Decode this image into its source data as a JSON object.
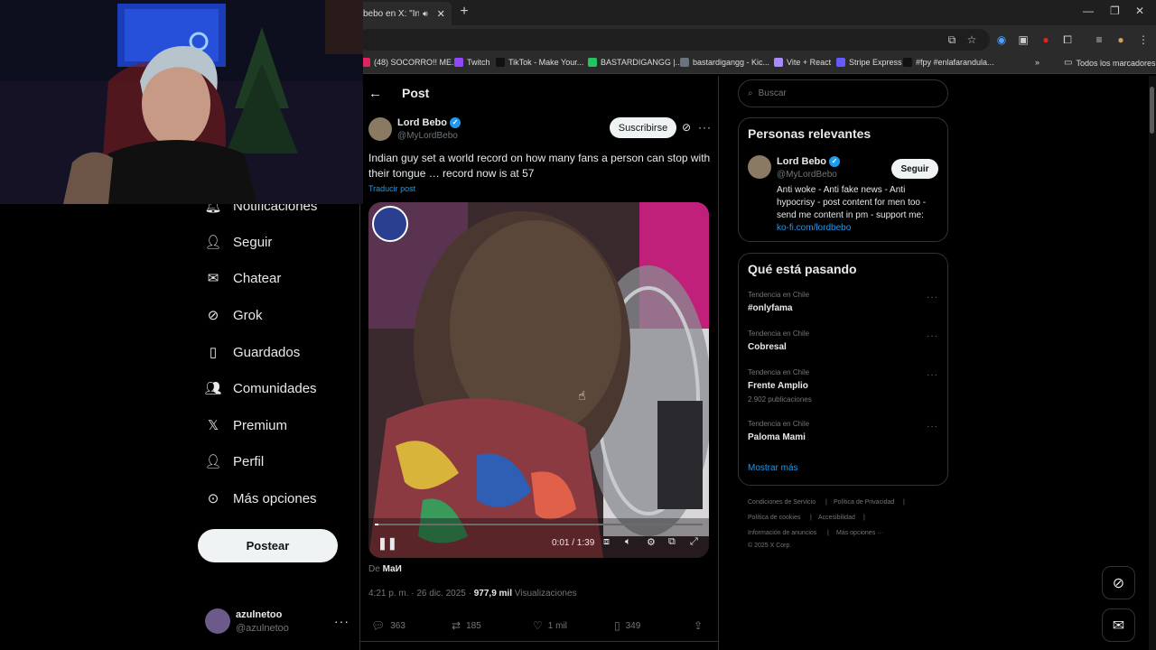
{
  "browser": {
    "tab_title": "bebo en X: \"Indian",
    "new_tab": "+",
    "bookmarks": [
      {
        "label": "(48) SOCORRO!! ME...",
        "color": "#e0245e"
      },
      {
        "label": "Twitch",
        "color": "#9146ff"
      },
      {
        "label": "TikTok - Make Your...",
        "color": "#111111"
      },
      {
        "label": "BASTARDIGANGG |...",
        "color": "#22c55e"
      },
      {
        "label": "bastardigangg - Kic...",
        "color": "#6b7280"
      },
      {
        "label": "Vite + React",
        "color": "#a78bfa"
      },
      {
        "label": "Stripe Express",
        "color": "#635bff"
      },
      {
        "label": "#fpy #enlafarandula...",
        "color": "#111111"
      }
    ],
    "all_bookmarks": "Todos los marcadores"
  },
  "nav": {
    "items": [
      {
        "label": "Notificaciones",
        "icon": "bell-icon"
      },
      {
        "label": "Seguir",
        "icon": "person-add-icon"
      },
      {
        "label": "Chatear",
        "icon": "mail-icon"
      },
      {
        "label": "Grok",
        "icon": "grok-icon"
      },
      {
        "label": "Guardados",
        "icon": "bookmark-icon"
      },
      {
        "label": "Comunidades",
        "icon": "communities-icon"
      },
      {
        "label": "Premium",
        "icon": "x-icon"
      },
      {
        "label": "Perfil",
        "icon": "profile-icon"
      },
      {
        "label": "Más opciones",
        "icon": "more-circle-icon"
      }
    ],
    "post_button": "Postear",
    "account": {
      "name": "azulnetoo",
      "handle": "@azulnetoo"
    }
  },
  "post": {
    "header_title": "Post",
    "author": {
      "name": "Lord Bebo",
      "handle": "@MyLordBebo"
    },
    "subscribe": "Suscribirse",
    "text": "Indian guy set a world record on how many fans a person can stop with their tongue … record now is at 57",
    "translate": "Traducir post",
    "video": {
      "time": "0:01 / 1:39",
      "progress": 0.01
    },
    "from_prefix": "De",
    "from_name": "МаИ",
    "meta_time": "4:21 p. m. · 26 dic. 2025 ·",
    "views_count": "977,9 mil",
    "views_label": "Visualizaciones",
    "stats": {
      "replies": "363",
      "reposts": "185",
      "likes": "1 mil",
      "bookmarks": "349"
    }
  },
  "sidebar": {
    "search_placeholder": "Buscar",
    "relevant_title": "Personas relevantes",
    "relevant_person": {
      "name": "Lord Bebo",
      "handle": "@MyLordBebo",
      "follow": "Seguir",
      "bio": "Anti woke - Anti fake news - Anti hypocrisy - post content for men too - send me content in pm - support me:",
      "link": "ko-fi.com/lordbebo"
    },
    "trends_title": "Qué está pasando",
    "trends": [
      {
        "category": "Tendencia en Chile",
        "name": "#onlyfama",
        "count": ""
      },
      {
        "category": "Tendencia en Chile",
        "name": "Cobresal",
        "count": ""
      },
      {
        "category": "Tendencia en Chile",
        "name": "Frente Amplio",
        "count": "2.902 publicaciones"
      },
      {
        "category": "Tendencia en Chile",
        "name": "Paloma Mami",
        "count": ""
      }
    ],
    "show_more": "Mostrar más",
    "footer": {
      "terms": "Condiciones de Servicio",
      "privacy": "Política de Privacidad",
      "cookies": "Política de cookies",
      "accessibility": "Accesibilidad",
      "ads": "Información de anuncios",
      "more": "Más opciones ···",
      "copyright": "© 2025 X Corp."
    }
  }
}
